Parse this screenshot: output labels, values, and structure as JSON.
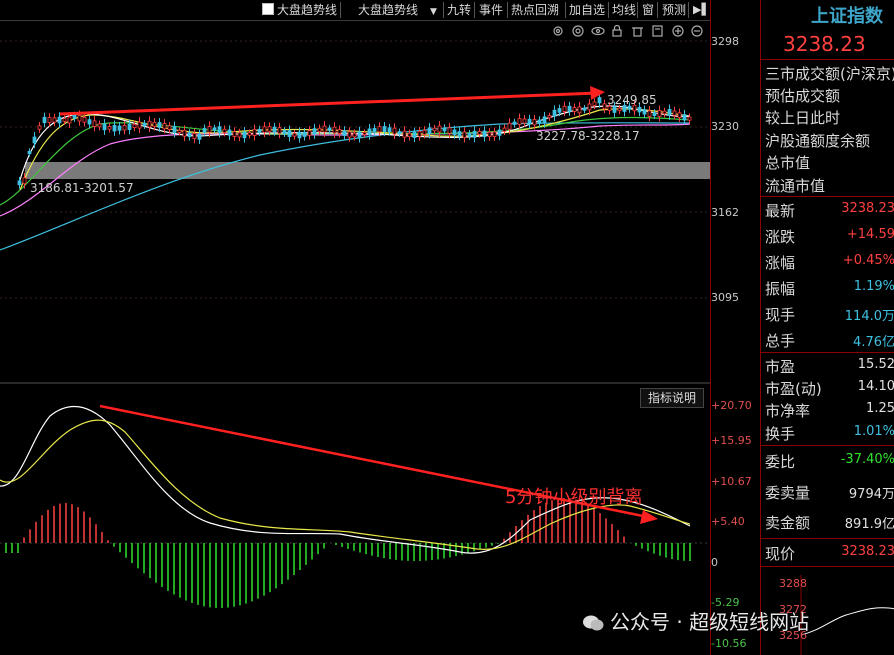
{
  "toolbar": {
    "checkbox_label": "大盘趋势线",
    "dropdown_value": "大盘趋势线",
    "items": [
      "九转",
      "事件",
      "热点回溯",
      "加自选",
      "均线",
      "窗",
      "预测"
    ]
  },
  "price_axis": {
    "ticks": [
      "3298",
      "3230",
      "3162",
      "3095"
    ]
  },
  "macd_axis": {
    "ticks": [
      "+20.70",
      "+15.95",
      "+10.67",
      "+5.40",
      "0",
      "-5.29",
      "-10.56"
    ]
  },
  "annotations": {
    "high_label": "3249.85",
    "range_label_right": "3227.78-3228.17",
    "range_label_left": "3186.81-3201.57",
    "divergence_text": "5分钟小级别背离",
    "indicator_button": "指标说明"
  },
  "panel": {
    "title": "上证指数",
    "price": "3238.23",
    "info_labels": [
      "三市成交额(沪深京)",
      "预估成交额",
      "较上日此时",
      "沪股通额度余额",
      "总市值",
      "流通市值"
    ],
    "stats": [
      {
        "label": "最新",
        "value": "3238.23",
        "color": "red"
      },
      {
        "label": "涨跌",
        "value": "+14.59",
        "color": "red"
      },
      {
        "label": "涨幅",
        "value": "+0.45%",
        "color": "red"
      },
      {
        "label": "振幅",
        "value": "1.19%",
        "color": "cyan"
      },
      {
        "label": "现手",
        "value": "114.0万",
        "color": "cyan"
      },
      {
        "label": "总手",
        "value": "4.76亿",
        "color": "cyan"
      }
    ],
    "ratios": [
      {
        "label": "市盈",
        "value": "15.52",
        "color": "white"
      },
      {
        "label": "市盈(动)",
        "value": "14.10",
        "color": "white"
      },
      {
        "label": "市净率",
        "value": "1.25",
        "color": "white"
      },
      {
        "label": "换手",
        "value": "1.01%",
        "color": "cyan"
      }
    ],
    "orders": [
      {
        "label": "委比",
        "value": "-37.40%",
        "color": "green"
      },
      {
        "label": "委卖量",
        "value": "9794万",
        "color": "white"
      },
      {
        "label": "卖金额",
        "value": "891.9亿",
        "color": "white"
      }
    ],
    "current_label": "现价",
    "current_value": "3238.23",
    "mini_ticks": [
      "3288",
      "3272",
      "3256"
    ]
  },
  "watermark": "公众号 · 超级短线网站",
  "colors": {
    "up": "#ff4040",
    "down": "#2ee02e",
    "ma_white": "#ffffff",
    "ma_yellow": "#e8e84a",
    "ma_green": "#3ec83e",
    "ma_pink": "#ff80ff",
    "ma_cyan": "#3ec0e0",
    "arrow": "#ff2020",
    "gap_band": "#7a7a7a"
  }
}
